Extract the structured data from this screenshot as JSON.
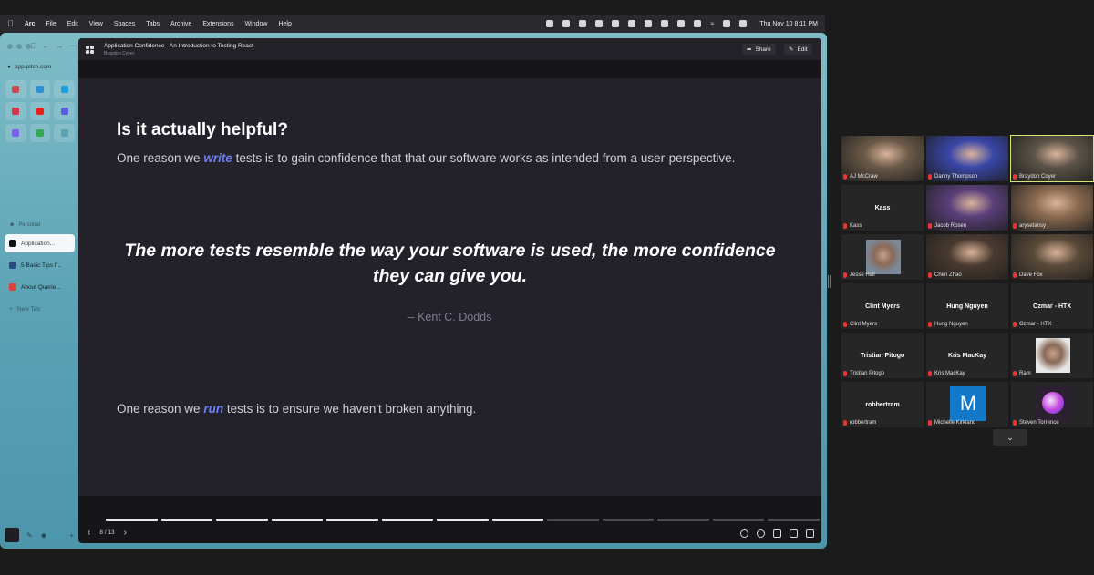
{
  "menubar": {
    "apple": "",
    "app": "Arc",
    "items": [
      "File",
      "Edit",
      "View",
      "Spaces",
      "Tabs",
      "Archive",
      "Extensions",
      "Window",
      "Help"
    ],
    "clock": "Thu Nov 10  8:11 PM"
  },
  "sidebar": {
    "url": "app.pitch.com",
    "pins": [
      {
        "icon": "pin-app-icon",
        "color": "#c74b50"
      },
      {
        "icon": "pin-app-icon",
        "color": "#2b8fd0"
      },
      {
        "icon": "pin-app-icon",
        "color": "#1a9ed8"
      },
      {
        "icon": "pin-app-icon",
        "color": "#d9344a"
      },
      {
        "icon": "youtube-icon",
        "color": "#e62117"
      },
      {
        "icon": "pin-app-icon",
        "color": "#5a5fe0"
      },
      {
        "icon": "messenger-icon",
        "color": "#7b5cf5"
      },
      {
        "icon": "pin-app-icon",
        "color": "#34a853"
      },
      {
        "icon": "pin-app-icon",
        "color": "#5aa2b4"
      }
    ],
    "space_label": "Personal",
    "tabs": [
      {
        "label": "Application...",
        "active": true,
        "color": "#111111"
      },
      {
        "label": "5 Basic Tips f...",
        "active": false,
        "color": "#2b4c7e"
      },
      {
        "label": "About Querie...",
        "active": false,
        "color": "#e0403a"
      }
    ],
    "new_tab": "New Tab"
  },
  "pitch": {
    "title": "Application Confidence - An Introduction to Testing React",
    "subtitle": "Braydon Coyer",
    "share_label": "Share",
    "edit_label": "Edit",
    "slide": {
      "heading": "Is it actually helpful?",
      "para1_before": "One reason we ",
      "para1_keyword": "write",
      "para1_after": " tests is to gain confidence that that our software works as intended from a user-perspective.",
      "quote": "The more tests resemble the way your software is used, the more confidence they can give you.",
      "author": "– Kent C. Dodds",
      "para2_before": "One reason we ",
      "para2_keyword": "run",
      "para2_after": " tests is to ensure we haven't broken anything."
    },
    "page_indicator": "8 / 13",
    "current_page": 8,
    "total_pages": 13
  },
  "zoom": {
    "participants": [
      {
        "name": "AJ McCraw",
        "kind": "video",
        "bg": "#6b5a48"
      },
      {
        "name": "Danny Thompson",
        "kind": "video",
        "bg": "#3946a8"
      },
      {
        "name": "Braydon Coyer",
        "kind": "video",
        "bg": "#5c5348",
        "active": true
      },
      {
        "name": "Kass",
        "kind": "name"
      },
      {
        "name": "Jacob Rosen",
        "kind": "video",
        "bg": "#5a3f7a"
      },
      {
        "name": "arysetansy",
        "kind": "video",
        "bg": "#8a6a50"
      },
      {
        "name": "Jesse Hall",
        "kind": "headshot",
        "bg": "#7a8a9a"
      },
      {
        "name": "Chen Zhao",
        "kind": "video",
        "bg": "#4a3a30"
      },
      {
        "name": "Dave Fox",
        "kind": "video",
        "bg": "#5a4a38"
      },
      {
        "name": "Clint Myers",
        "kind": "name"
      },
      {
        "name": "Hung Nguyen",
        "kind": "name"
      },
      {
        "name": "Ozmar - HTX",
        "kind": "name"
      },
      {
        "name": "Tristian Pitogo",
        "kind": "name"
      },
      {
        "name": "Kris MacKay",
        "kind": "name"
      },
      {
        "name": "Ram",
        "kind": "headshot",
        "bg": "#e8e8e8"
      },
      {
        "name": "robbertram",
        "kind": "name"
      },
      {
        "name": "Michelle Kirkland",
        "kind": "avatar-m",
        "initial": "M"
      },
      {
        "name": "Steven Torrence",
        "kind": "orb"
      }
    ],
    "more": "⌄"
  }
}
